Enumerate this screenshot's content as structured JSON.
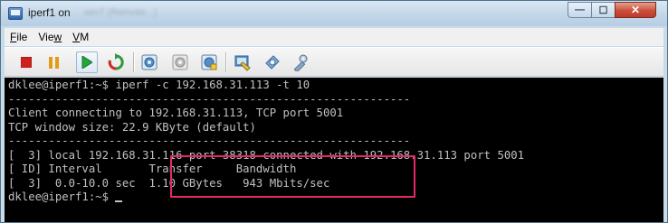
{
  "window": {
    "title": "iperf1 on",
    "title_obscured": "win7 (Remote...)",
    "close_symbol": "✕",
    "maximize_symbol": "☐",
    "minimize_symbol": "—"
  },
  "menu": {
    "items": [
      {
        "label_ul": "F",
        "label_rest": "ile"
      },
      {
        "label_pre": "Vie",
        "label_ul": "w"
      },
      {
        "label_ul": "V",
        "label_rest": "M"
      }
    ]
  },
  "toolbar": {
    "buttons": [
      "stop-icon",
      "pause-icon",
      "play-icon",
      "reset-icon",
      "snapshot-icon",
      "revert-snapshot-icon",
      "snapshot-manager-icon",
      "settings-icon",
      "tools-icon",
      "wrench-icon"
    ],
    "colors": {
      "stop": "#d0211b",
      "pause": "#e39a16",
      "play": "#23a63a"
    }
  },
  "terminal": {
    "lines": [
      "dklee@iperf1:~$ iperf -c 192.168.31.113 -t 10",
      "------------------------------------------------------------",
      "Client connecting to 192.168.31.113, TCP port 5001",
      "TCP window size: 22.9 KByte (default)",
      "------------------------------------------------------------",
      "[  3] local 192.168.31.116 port 38318 connected with 192.168.31.113 port 5001",
      "[ ID] Interval       Transfer     Bandwidth",
      "[  3]  0.0-10.0 sec  1.10 GBytes   943 Mbits/sec",
      "dklee@iperf1:~$ "
    ],
    "highlight_color": "#e3296a"
  }
}
